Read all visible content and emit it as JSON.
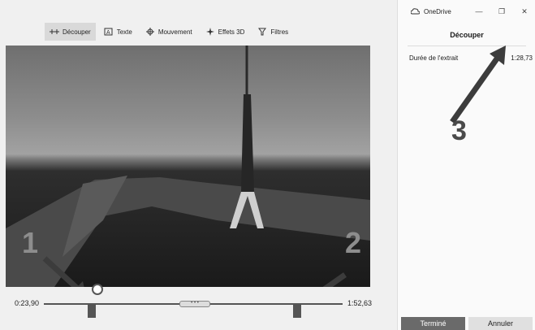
{
  "toolbar": {
    "items": [
      {
        "label": "Découper",
        "icon": "trim-icon",
        "active": true
      },
      {
        "label": "Texte",
        "icon": "text-icon",
        "active": false
      },
      {
        "label": "Mouvement",
        "icon": "move-icon",
        "active": false
      },
      {
        "label": "Effets 3D",
        "icon": "effects-3d-icon",
        "active": false
      },
      {
        "label": "Filtres",
        "icon": "filter-icon",
        "active": false
      }
    ]
  },
  "timeline": {
    "start_time": "0:23,90",
    "end_time": "1:52,63",
    "scrub_label": "• • •"
  },
  "window": {
    "app_name": "OneDrive",
    "app_icon": "cloud-icon",
    "minimize": "—",
    "restore": "❐",
    "close": "✕"
  },
  "panel": {
    "title": "Découper",
    "clip_duration_label": "Durée de l'extrait",
    "clip_duration_value": "1:28,73",
    "done_label": "Terminé",
    "cancel_label": "Annuler"
  },
  "annotations": {
    "one": "1",
    "two": "2",
    "three": "3"
  }
}
